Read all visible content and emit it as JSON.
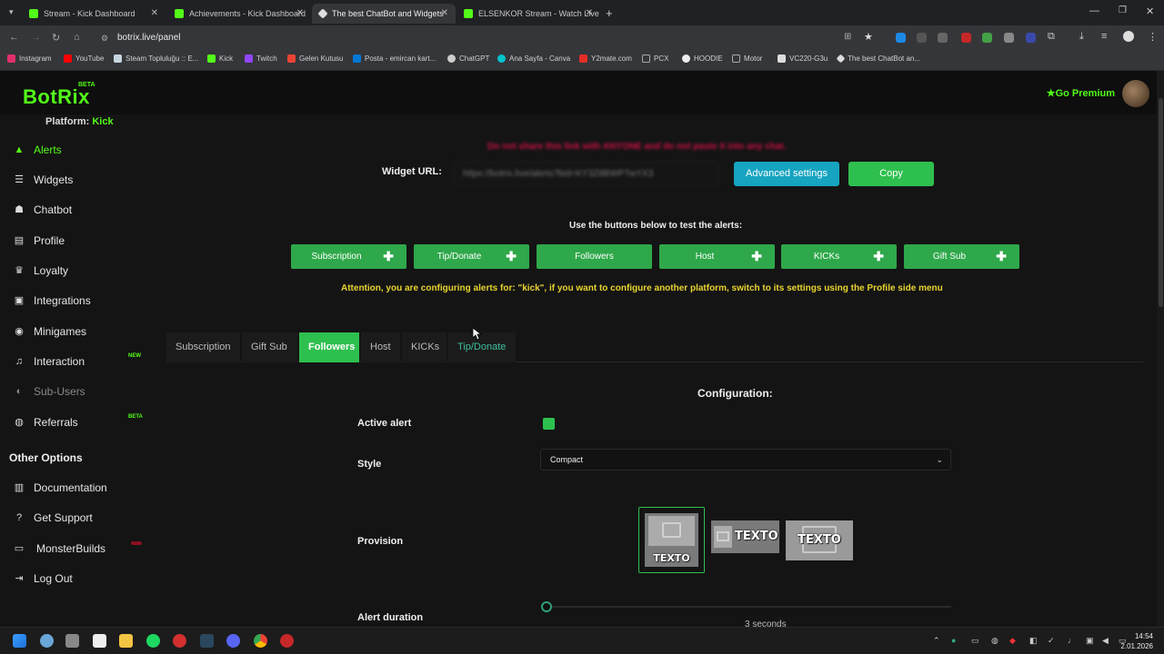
{
  "browser": {
    "tabs": [
      {
        "title": "Stream - Kick Dashboard",
        "fav": "#53fc18"
      },
      {
        "title": "Achievements - Kick Dashboard",
        "fav": "#53fc18"
      },
      {
        "title": "The best ChatBot and Widgets",
        "fav": "#dddddd"
      },
      {
        "title": "ELSENKOR Stream - Watch Live",
        "fav": "#53fc18"
      }
    ],
    "new_tab": "+",
    "url": "botrix.live/panel",
    "bookmarks": [
      {
        "label": "Instagram",
        "color": "#e1306c"
      },
      {
        "label": "YouTube",
        "color": "#ff0000"
      },
      {
        "label": "Steam Topluluğu :: E...",
        "color": "#c7d5e0"
      },
      {
        "label": "Kick",
        "color": "#53fc18"
      },
      {
        "label": "Twitch",
        "color": "#9146ff"
      },
      {
        "label": "Gelen Kutusu",
        "color": "#ea4335"
      },
      {
        "label": "Posta - emircan kart...",
        "color": "#0078d4"
      },
      {
        "label": "ChatGPT",
        "color": "#cccccc"
      },
      {
        "label": "Ana Sayfa - Canva",
        "color": "#00c4cc"
      },
      {
        "label": "Y2mate.com",
        "color": "#e52d27"
      },
      {
        "label": "PCX",
        "color": "#aaaaaa"
      },
      {
        "label": "HOODIE",
        "color": "#eeeeee"
      },
      {
        "label": "Motor",
        "color": "#aaaaaa"
      },
      {
        "label": "VC220-G3u",
        "color": "#dddddd"
      },
      {
        "label": "The best ChatBot an...",
        "color": "#dddddd"
      }
    ]
  },
  "app": {
    "logo": "BotRix",
    "logo_badge": "BETA",
    "premium": "Go Premium",
    "platform_label": "Platform:",
    "platform_value": "Kick"
  },
  "sidebar": {
    "items": [
      {
        "label": "Alerts",
        "icon": "warning-icon",
        "glyph": "▲"
      },
      {
        "label": "Widgets",
        "icon": "list-icon",
        "glyph": "☰"
      },
      {
        "label": "Chatbot",
        "icon": "robot-icon",
        "glyph": "☗"
      },
      {
        "label": "Profile",
        "icon": "id-card-icon",
        "glyph": "▤"
      },
      {
        "label": "Loyalty",
        "icon": "trophy-icon",
        "glyph": "♛"
      },
      {
        "label": "Integrations",
        "icon": "integrations-icon",
        "glyph": "▣"
      },
      {
        "label": "Minigames",
        "icon": "gamepad-icon",
        "glyph": "◉"
      },
      {
        "label": "Interaction",
        "icon": "music-icon",
        "glyph": "♫",
        "badge": "NEW"
      },
      {
        "label": "Sub-Users",
        "icon": "users-icon",
        "glyph": "◐"
      },
      {
        "label": "Referrals",
        "icon": "referrals-icon",
        "glyph": "◍",
        "badge": "BETA"
      }
    ],
    "other_title": "Other Options",
    "other_items": [
      {
        "label": "Documentation",
        "icon": "book-icon",
        "glyph": "▥"
      },
      {
        "label": "Get Support",
        "icon": "help-icon",
        "glyph": "?"
      },
      {
        "label": "MonsterBuilds",
        "icon": "laptop-icon",
        "glyph": "▭"
      },
      {
        "label": "Log Out",
        "icon": "logout-icon",
        "glyph": "⇥"
      }
    ]
  },
  "main": {
    "warning": "Do not share this link with ANYONE and do not paste it into any chat.",
    "widget_url_label": "Widget URL:",
    "widget_url_value": "https://botrix.live/alerts?bid=KY3Z8BWPTwYX3",
    "advanced_label": "Advanced settings",
    "copy_label": "Copy",
    "test_hint": "Use the buttons below to test the alerts:",
    "test_buttons": [
      {
        "label": "Subscription",
        "plus": true
      },
      {
        "label": "Tip/Donate",
        "plus": true
      },
      {
        "label": "Followers",
        "plus": false
      },
      {
        "label": "Host",
        "plus": true
      },
      {
        "label": "KICKs",
        "plus": true
      },
      {
        "label": "Gift Sub",
        "plus": true
      }
    ],
    "attention": "Attention, you are configuring alerts for: \"kick\", if you want to configure another platform, switch to its settings using the Profile side menu",
    "config_tabs": [
      "Subscription",
      "Gift Sub",
      "Followers",
      "Host",
      "KICKs",
      "Tip/Donate"
    ],
    "active_tab": "Followers",
    "config_title": "Configuration:",
    "active_alert_label": "Active alert",
    "active_alert_value": true,
    "style_label": "Style",
    "style_value": "Compact",
    "provision_label": "Provision",
    "provision_text": "TEXTO",
    "duration_label": "Alert duration",
    "duration_value": "3 seconds"
  },
  "taskbar": {
    "time": "14:54",
    "date": "2.01.2026"
  },
  "colors": {
    "kick_green": "#53fc18",
    "button_green": "#2ec04e",
    "teal": "#16a4c0",
    "warning_red": "#cc1144",
    "attention_yellow": "#e8d430"
  }
}
